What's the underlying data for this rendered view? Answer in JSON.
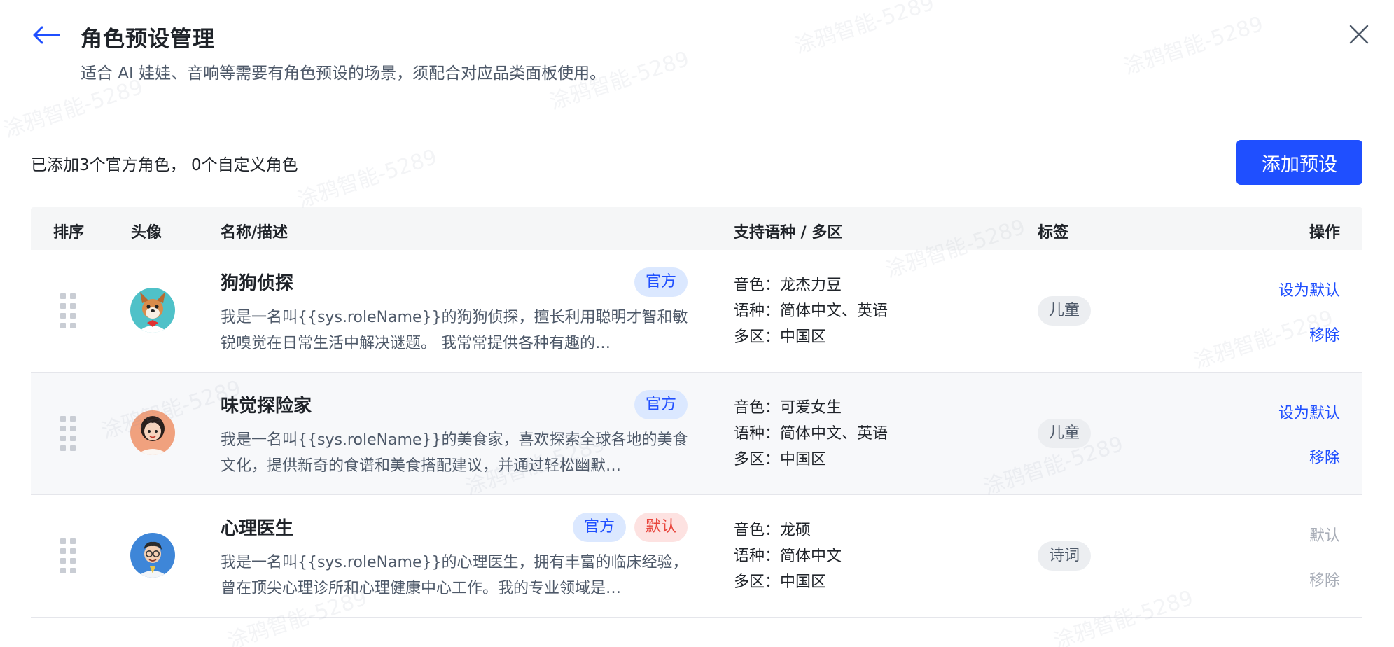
{
  "header": {
    "title": "角色预设管理",
    "subtitle": "适合 AI 娃娃、音响等需要有角色预设的场景，须配合对应品类面板使用。"
  },
  "summary": "已添加3个官方角色， 0个自定义角色",
  "add_button": "添加预设",
  "table": {
    "columns": {
      "order": "排序",
      "avatar": "头像",
      "name_desc": "名称/描述",
      "language_region": "支持语种 / 多区",
      "tags": "标签",
      "actions": "操作"
    },
    "rows": [
      {
        "name": "狗狗侦探",
        "description": "我是一名叫{{sys.roleName}}的狗狗侦探，擅长利用聪明才智和敏锐嗅觉在日常生活中解决谜题。 我常常提供各种有趣的…",
        "badges": [
          "官方"
        ],
        "voice_label": "音色：",
        "voice": "龙杰力豆",
        "language_label": "语种：",
        "language": "简体中文、英语",
        "region_label": "多区：",
        "region": "中国区",
        "tag": "儿童",
        "action_primary": "设为默认",
        "action_secondary": "移除",
        "is_default": false,
        "avatar_icon": "dog-avatar"
      },
      {
        "name": "味觉探险家",
        "description": "我是一名叫{{sys.roleName}}的美食家，喜欢探索全球各地的美食文化，提供新奇的食谱和美食搭配建议，并通过轻松幽默…",
        "badges": [
          "官方"
        ],
        "voice_label": "音色：",
        "voice": "可爱女生",
        "language_label": "语种：",
        "language": "简体中文、英语",
        "region_label": "多区：",
        "region": "中国区",
        "tag": "儿童",
        "action_primary": "设为默认",
        "action_secondary": "移除",
        "is_default": false,
        "avatar_icon": "girl-avatar"
      },
      {
        "name": "心理医生",
        "description": "我是一名叫{{sys.roleName}}的心理医生，拥有丰富的临床经验，曾在顶尖心理诊所和心理健康中心工作。我的专业领域是…",
        "badges": [
          "官方",
          "默认"
        ],
        "voice_label": "音色：",
        "voice": "龙硕",
        "language_label": "语种：",
        "language": "简体中文",
        "region_label": "多区：",
        "region": "中国区",
        "tag": "诗词",
        "action_primary": "默认",
        "action_secondary": "移除",
        "is_default": true,
        "avatar_icon": "doctor-avatar"
      }
    ]
  },
  "watermark_text": "涂鸦智能-5289",
  "colors": {
    "primary": "#1f4fff",
    "official_badge_bg": "#dbe8ff",
    "default_badge_bg": "#fde2e1",
    "default_badge_text": "#e8453c",
    "disabled_text": "#a9aeb8"
  }
}
